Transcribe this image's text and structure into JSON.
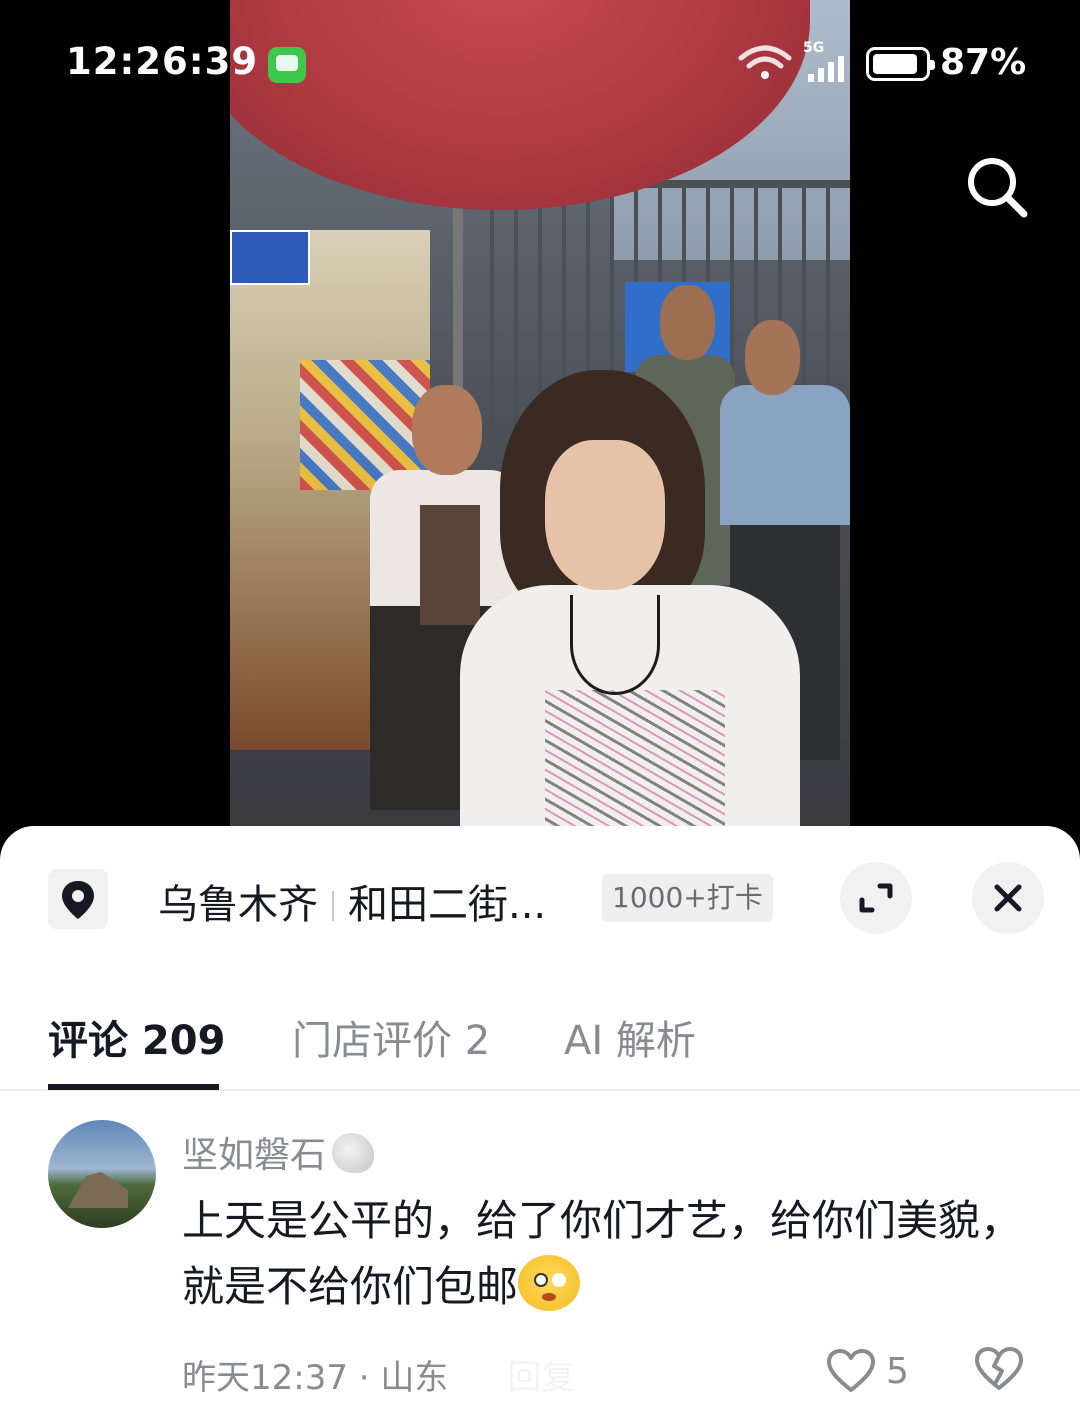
{
  "status_bar": {
    "time": "12:26:39",
    "network": "5G",
    "battery_percent": "87%",
    "battery_level": 0.87,
    "icons": [
      "message-icon",
      "wifi-icon",
      "signal-icon",
      "battery-icon"
    ]
  },
  "video": {
    "search_icon": "search-icon"
  },
  "location": {
    "pin_icon": "location-pin-icon",
    "city": "乌鲁木齐",
    "place": "和田二街...",
    "checkins": "1000+打卡",
    "expand_icon": "expand-icon",
    "close_icon": "close-icon"
  },
  "tabs": [
    {
      "label": "评论 209",
      "active": true
    },
    {
      "label": "门店评价 2",
      "active": false
    },
    {
      "label": "AI 解析",
      "active": false
    }
  ],
  "comments": [
    {
      "username": "坚如磐石",
      "text": "上天是公平的，给了你们才艺，给你们美貌，就是不给你们包邮",
      "time": "昨天12:37",
      "separator": "·",
      "region": "山东",
      "reply_label": "回复",
      "likes": "5",
      "icons": [
        "avatar",
        "user-badge-icon",
        "emoji-icon",
        "heart-icon",
        "broken-heart-icon"
      ]
    }
  ],
  "colors": {
    "sheet_bg": "#ffffff",
    "primary_text": "#161823",
    "secondary_text": "#8a8b91",
    "status_green": "#3ec74d"
  }
}
